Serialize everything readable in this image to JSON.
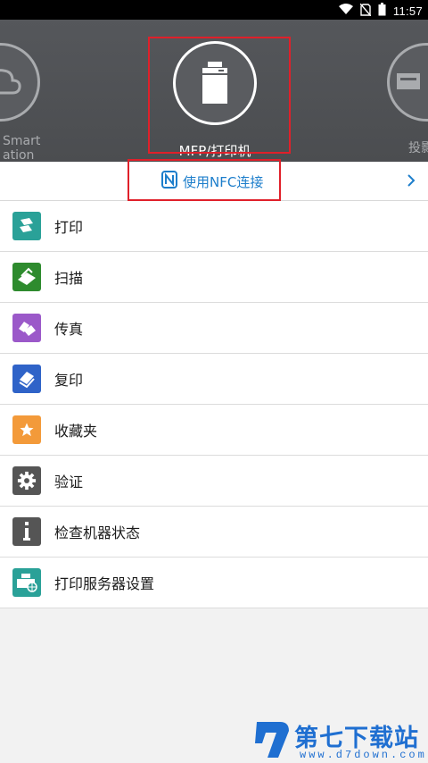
{
  "status_bar": {
    "time": "11:57",
    "icons": [
      "wifi-icon",
      "no-sim-icon",
      "battery-icon"
    ]
  },
  "devices": {
    "left": {
      "label_line1": "Smart",
      "label_line2": "ation"
    },
    "center": {
      "label": "MFP/打印机"
    },
    "right": {
      "label": "投影"
    }
  },
  "nfc": {
    "label": "使用NFC连接",
    "color": "#1d7ecb"
  },
  "menu": [
    {
      "label": "打印",
      "icon": "print-icon",
      "color": "#2aa198"
    },
    {
      "label": "扫描",
      "icon": "scan-icon",
      "color": "#2e8b2e"
    },
    {
      "label": "传真",
      "icon": "fax-icon",
      "color": "#9b59c9"
    },
    {
      "label": "复印",
      "icon": "copy-icon",
      "color": "#2f63c8"
    },
    {
      "label": "收藏夹",
      "icon": "star-icon",
      "color": "#f39a3a"
    },
    {
      "label": "验证",
      "icon": "gear-icon",
      "color": "#555555"
    },
    {
      "label": "检查机器状态",
      "icon": "info-icon",
      "color": "#555555"
    },
    {
      "label": "打印服务器设置",
      "icon": "print-server-icon",
      "color": "#2aa198"
    }
  ],
  "watermark": {
    "title": "第七下载站",
    "url": "www.d7down.com"
  }
}
